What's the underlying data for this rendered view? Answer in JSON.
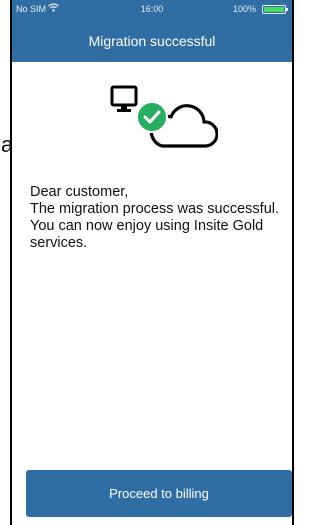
{
  "status_bar": {
    "carrier": "No SIM",
    "time": "16:00",
    "battery_pct": "100%"
  },
  "header": {
    "title": "Migration successful"
  },
  "illustration": {
    "icons": [
      "computer-icon",
      "check-circle-icon",
      "cloud-icon"
    ],
    "check_color": "#27ae60"
  },
  "message": {
    "lines": [
      "Dear customer,",
      "The migration process was successful.",
      "You can now enjoy using Insite Gold",
      "services."
    ]
  },
  "footer": {
    "button_label": "Proceed to billing"
  },
  "background_fragment": {
    "text": "a."
  },
  "colors": {
    "header": "#2f6da2",
    "button": "#2f6da2",
    "battery": "#4cd964"
  }
}
